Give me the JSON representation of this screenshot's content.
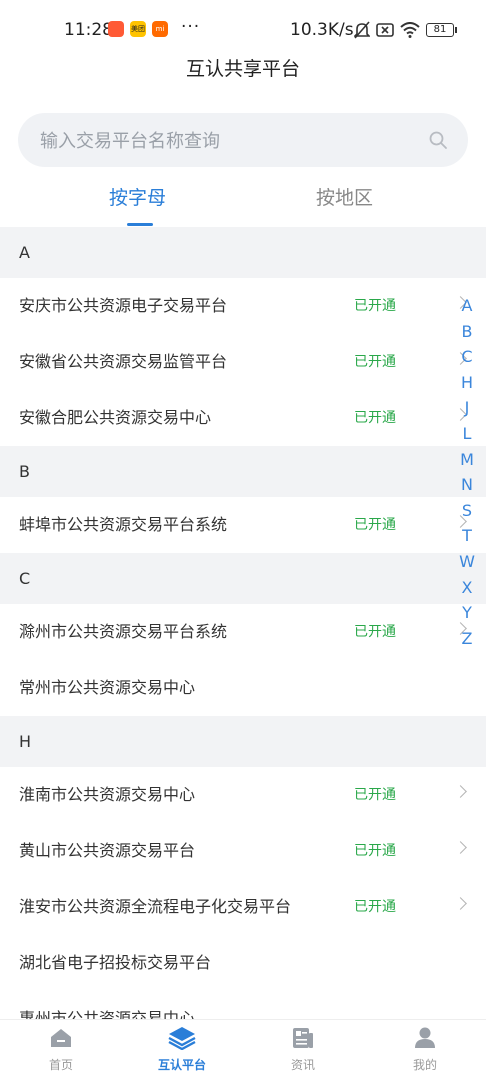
{
  "status_bar": {
    "time": "11:28",
    "notification_apps": [
      {
        "icon": "app-orange-icon",
        "color": "#ff5a35"
      },
      {
        "icon": "meituan-icon",
        "color": "#ffc300",
        "text": "美团"
      },
      {
        "icon": "mi-icon",
        "color": "#ff6a00",
        "text": "mi"
      }
    ],
    "more": "···",
    "network_speed": "10.3K/s",
    "battery": "81"
  },
  "header": {
    "title": "互认共享平台"
  },
  "search": {
    "placeholder": "输入交易平台名称查询",
    "value": ""
  },
  "tabs": [
    {
      "label": "按字母",
      "active": true
    },
    {
      "label": "按地区",
      "active": false
    }
  ],
  "sections": [
    {
      "letter": "A",
      "items": [
        {
          "name": "安庆市公共资源电子交易平台",
          "status": "已开通",
          "arrow": true
        },
        {
          "name": "安徽省公共资源交易监管平台",
          "status": "已开通",
          "arrow": true
        },
        {
          "name": "安徽合肥公共资源交易中心",
          "status": "已开通",
          "arrow": true
        }
      ]
    },
    {
      "letter": "B",
      "items": [
        {
          "name": "蚌埠市公共资源交易平台系统",
          "status": "已开通",
          "arrow": true
        }
      ]
    },
    {
      "letter": "C",
      "items": [
        {
          "name": "滁州市公共资源交易平台系统",
          "status": "已开通",
          "arrow": true
        },
        {
          "name": "常州市公共资源交易中心",
          "status": "",
          "arrow": false
        }
      ]
    },
    {
      "letter": "H",
      "items": [
        {
          "name": "淮南市公共资源交易中心",
          "status": "已开通",
          "arrow": true
        },
        {
          "name": "黄山市公共资源交易平台",
          "status": "已开通",
          "arrow": true
        },
        {
          "name": "淮安市公共资源全流程电子化交易平台",
          "status": "已开通",
          "arrow": true
        },
        {
          "name": "湖北省电子招投标交易平台",
          "status": "",
          "arrow": false
        },
        {
          "name": "惠州市公共资源交易中心",
          "status": "",
          "arrow": false
        }
      ]
    }
  ],
  "alphabet_index": [
    "A",
    "B",
    "C",
    "H",
    "J",
    "L",
    "M",
    "N",
    "S",
    "T",
    "W",
    "X",
    "Y",
    "Z"
  ],
  "bottom_nav": [
    {
      "label": "首页",
      "icon": "home-icon",
      "active": false
    },
    {
      "label": "互认平台",
      "icon": "layers-icon",
      "active": true
    },
    {
      "label": "资讯",
      "icon": "news-icon",
      "active": false
    },
    {
      "label": "我的",
      "icon": "user-icon",
      "active": false
    }
  ],
  "colors": {
    "accent": "#2a7ed8",
    "status_green": "#2aa84a",
    "section_bg": "#f2f3f5",
    "inactive": "#999999"
  }
}
